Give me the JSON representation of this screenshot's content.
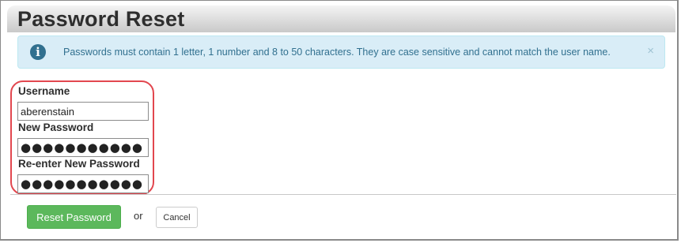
{
  "page": {
    "title": "Password Reset"
  },
  "alert": {
    "icon": "info-icon",
    "text": "Passwords must contain 1 letter, 1 number and 8 to 50 characters. They are case sensitive and cannot match the user name.",
    "close_symbol": "×",
    "colors": {
      "background": "#d9edf7",
      "text": "#31708f"
    }
  },
  "form": {
    "username": {
      "label": "Username",
      "value": "aberenstain"
    },
    "new_password": {
      "label": "New Password",
      "value": "●●●●●●●●●●●"
    },
    "reenter_password": {
      "label": "Re-enter New Password",
      "value": "●●●●●●●●●●●"
    }
  },
  "actions": {
    "reset_label": "Reset Password",
    "or_text": "or",
    "cancel_label": "Cancel",
    "colors": {
      "reset": "#5cb85c",
      "highlight_outline": "#e2474f"
    }
  }
}
